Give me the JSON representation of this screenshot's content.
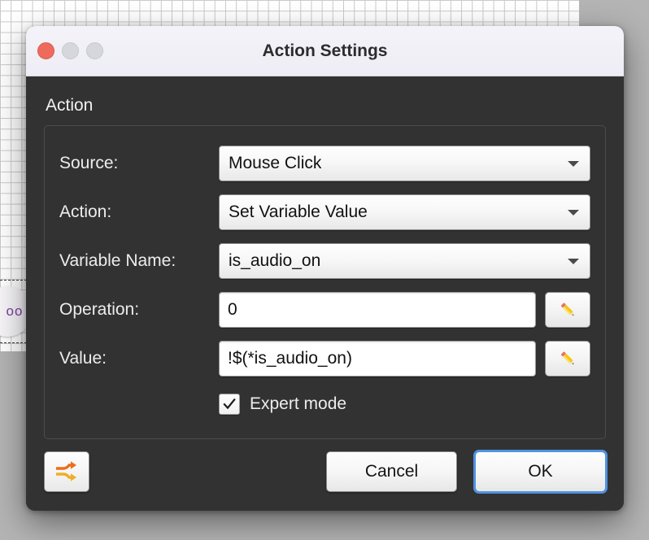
{
  "background": {
    "canvas_node_label": "oo",
    "grid_color": "#c9c9c9",
    "surface_color": "#b4b4b4"
  },
  "window": {
    "title": "Action Settings",
    "traffic_lights": [
      {
        "name": "close",
        "color": "#ee6a5c"
      },
      {
        "name": "minimize",
        "color": "#d6d7dd"
      },
      {
        "name": "zoom",
        "color": "#d6d7dd"
      }
    ]
  },
  "section": {
    "title": "Action"
  },
  "fields": {
    "source": {
      "label": "Source:",
      "value": "Mouse Click",
      "control": "dropdown"
    },
    "action": {
      "label": "Action:",
      "value": "Set Variable Value",
      "control": "dropdown"
    },
    "variable_name": {
      "label": "Variable Name:",
      "value": "is_audio_on",
      "control": "dropdown"
    },
    "operation": {
      "label": "Operation:",
      "value": "0",
      "placeholder": "",
      "control": "text",
      "edit_button_icon": "pencil-icon"
    },
    "value": {
      "label": "Value:",
      "value": "!$(*is_audio_on)",
      "placeholder": "",
      "control": "text",
      "edit_button_icon": "pencil-icon"
    }
  },
  "expert_mode": {
    "label": "Expert mode",
    "checked": true,
    "check_glyph": "✓"
  },
  "footer": {
    "shuffle_label": "",
    "shuffle_icon": "shuffle-arrows-icon",
    "cancel_label": "Cancel",
    "ok_label": "OK",
    "default_button": "OK",
    "focus_ring_color": "#4f92e0"
  },
  "colors": {
    "dialog_background": "#323232",
    "titlebar_background": "#f1f0f7",
    "label_text": "#ededed",
    "shuffle_icon_primary": "#e8701a",
    "shuffle_icon_secondary": "#f0ad28"
  }
}
